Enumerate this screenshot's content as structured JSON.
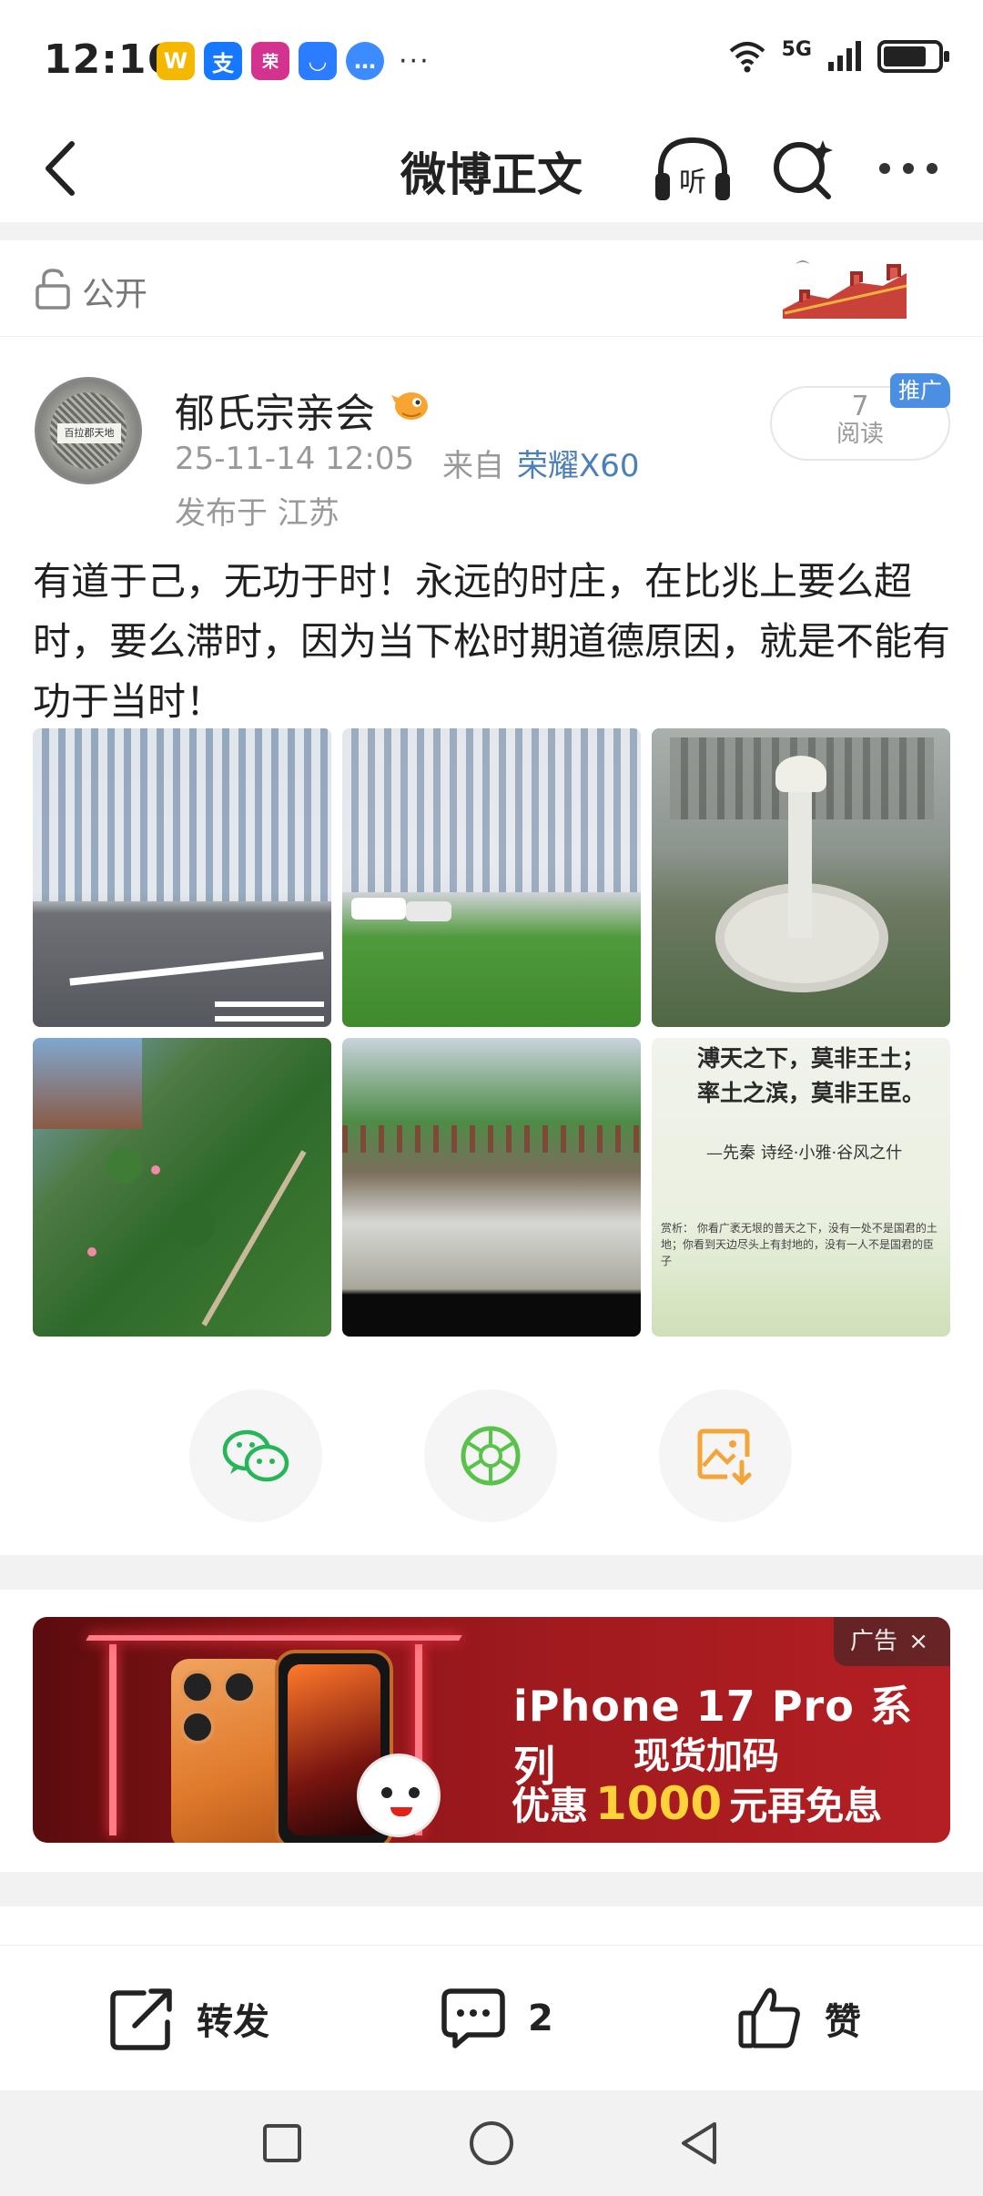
{
  "status_bar": {
    "time": "12:16",
    "network": "5G",
    "more": "···",
    "apps": [
      {
        "name": "weibo-app-icon",
        "glyph": "W",
        "color": "#f5b800"
      },
      {
        "name": "alipay-app-icon",
        "glyph": "支",
        "color": "#1677ff"
      },
      {
        "name": "promo-app-icon",
        "glyph": "荣",
        "color": "#d3338f"
      },
      {
        "name": "honor-store-app-icon",
        "glyph": "◡",
        "color": "#2b7cff"
      },
      {
        "name": "message-app-icon",
        "glyph": "…",
        "color": "#3c8cff"
      }
    ]
  },
  "header": {
    "title": "微博正文",
    "listen_label": "听"
  },
  "visibility": {
    "label": "公开"
  },
  "post": {
    "author": "郁氏宗亲会",
    "time": "25-11-14 12:05",
    "source_prefix": "来自",
    "device": "荣耀X60",
    "location": "发布于 江苏",
    "read_count": "7",
    "read_label": "阅读",
    "promo_tag": "推广",
    "text": "有道于己，无功于时！永远的时庄，在比兆上要么超时，要么滞时，因为当下松时期道德原因，就是不能有功于当时！",
    "poem_image": {
      "line1": "溥天之下，莫非王土；",
      "line2": "率土之滨，莫非王臣。",
      "source": "—先秦  诗经·小雅·谷风之什",
      "note": "赏析：\n你看广袤无垠的普天之下，没有一处不是国君的土地；你看到天边尽头上有封地的，没有一人不是国君的臣子"
    }
  },
  "share": {
    "wechat": "wechat-share",
    "moments": "moments-share",
    "save_image": "save-image"
  },
  "ad": {
    "line1": "iPhone 17 Pro 系列",
    "line2": "现货加码",
    "line3_pre": "优惠",
    "line3_highlight": "1000",
    "line3_post": "元再免息",
    "tag": "广告"
  },
  "actions": {
    "repost": "转发",
    "comment_count": "2",
    "like": "赞"
  }
}
